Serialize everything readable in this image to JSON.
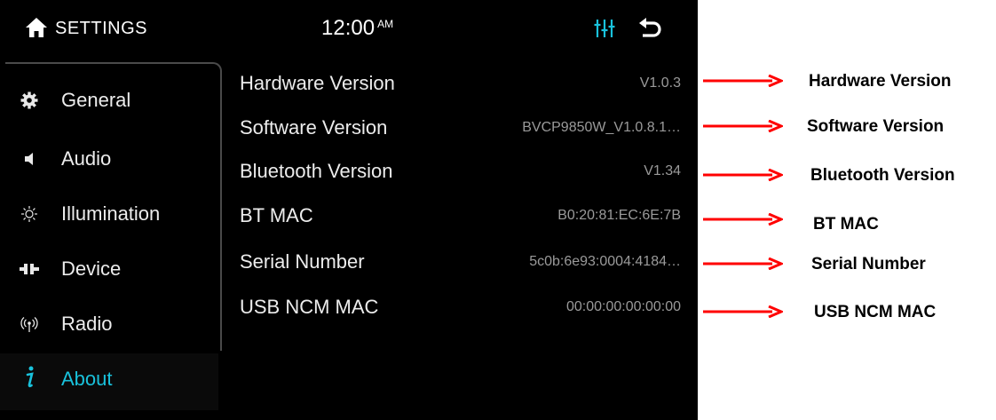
{
  "header": {
    "title": "SETTINGS",
    "time": "12:00",
    "ampm": "AM",
    "home_icon": "home-icon",
    "eq_icon": "equalizer-icon",
    "back_icon": "back-icon"
  },
  "sidebar": {
    "items": [
      {
        "label": "General",
        "icon": "gear-icon"
      },
      {
        "label": "Audio",
        "icon": "speaker-icon"
      },
      {
        "label": "Illumination",
        "icon": "sun-icon"
      },
      {
        "label": "Device",
        "icon": "device-icon"
      },
      {
        "label": "Radio",
        "icon": "radio-icon"
      },
      {
        "label": "About",
        "icon": "info-icon",
        "active": true
      }
    ]
  },
  "about": {
    "rows": [
      {
        "key": "Hardware Version",
        "value": "V1.0.3"
      },
      {
        "key": "Software Version",
        "value": "BVCP9850W_V1.0.8.1…"
      },
      {
        "key": "Bluetooth Version",
        "value": "V1.34"
      },
      {
        "key": "BT MAC",
        "value": "B0:20:81:EC:6E:7B"
      },
      {
        "key": "Serial Number",
        "value": "5c0b:6e93:0004:4184…"
      },
      {
        "key": "USB NCM MAC",
        "value": "00:00:00:00:00:00"
      }
    ]
  },
  "annotations": [
    "Hardware  Version",
    "Software Version",
    "Bluetooth Version",
    "BT MAC",
    "Serial Number",
    "USB NCM MAC"
  ],
  "colors": {
    "screen_bg": "#000000",
    "accent": "#19c2dc",
    "arrow": "#ff0000",
    "value_text": "#9a9a9a"
  }
}
